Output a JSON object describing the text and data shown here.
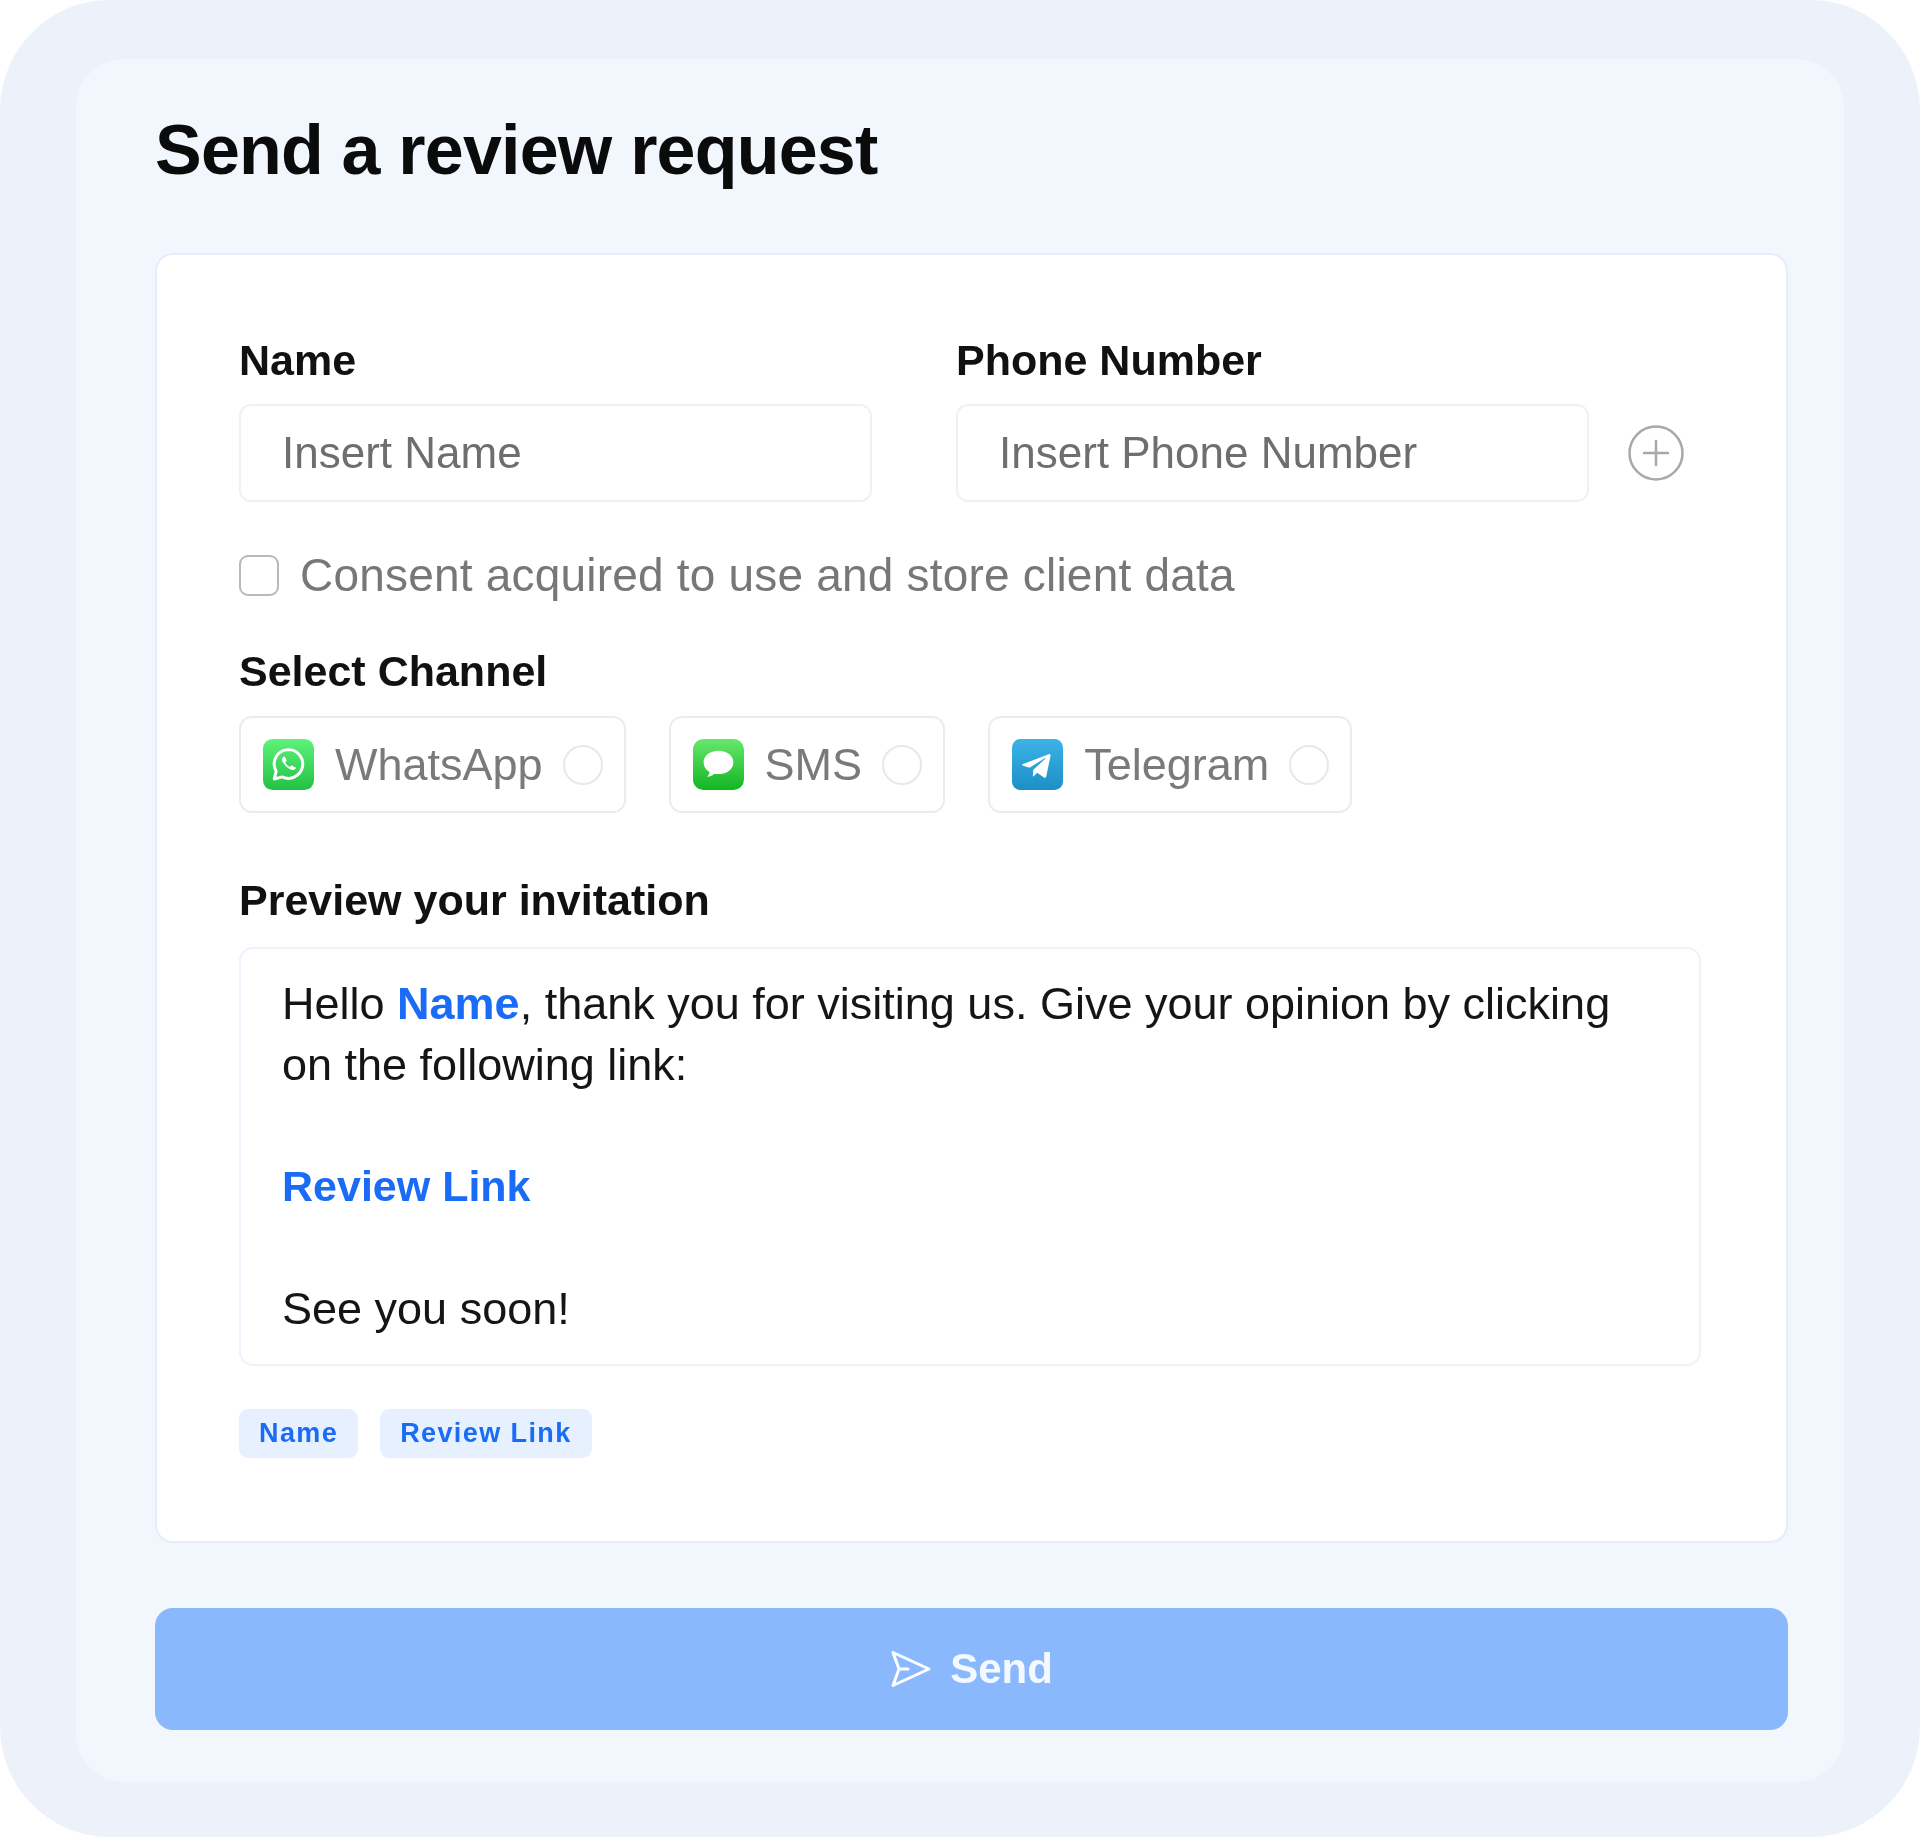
{
  "title": "Send a review request",
  "fields": [
    {
      "kind": "text",
      "label": "Name",
      "placeholder": "Insert Name"
    },
    {
      "kind": "phone",
      "label": "Phone Number",
      "placeholder": "Insert Phone Number"
    }
  ],
  "consent": {
    "label": "Consent acquired to use and store client data",
    "checked": false
  },
  "channel_picker": {
    "label": "Select Channel",
    "channels": [
      {
        "kind": "whatsapp",
        "name": "WhatsApp",
        "selected": false
      },
      {
        "kind": "sms",
        "name": "SMS",
        "selected": false
      },
      {
        "kind": "telegram",
        "name": "Telegram",
        "selected": false
      }
    ]
  },
  "preview": {
    "label": "Preview your invitation",
    "paragraphs": [
      {
        "kind": "text",
        "parts": [
          {
            "kind": "plain",
            "text": "Hello "
          },
          {
            "kind": "variable",
            "text": "Name"
          },
          {
            "kind": "plain",
            "text": ", thank you for visiting us. Give your opinion by clicking on the following link:"
          }
        ]
      },
      {
        "kind": "link",
        "text": "Review Link"
      },
      {
        "kind": "text",
        "parts": [
          {
            "kind": "plain",
            "text": "See you soon!"
          }
        ]
      }
    ]
  },
  "tags": [
    {
      "label": "Name"
    },
    {
      "label": "Review Link"
    }
  ],
  "send_button": {
    "label": "Send",
    "disabled": true
  }
}
